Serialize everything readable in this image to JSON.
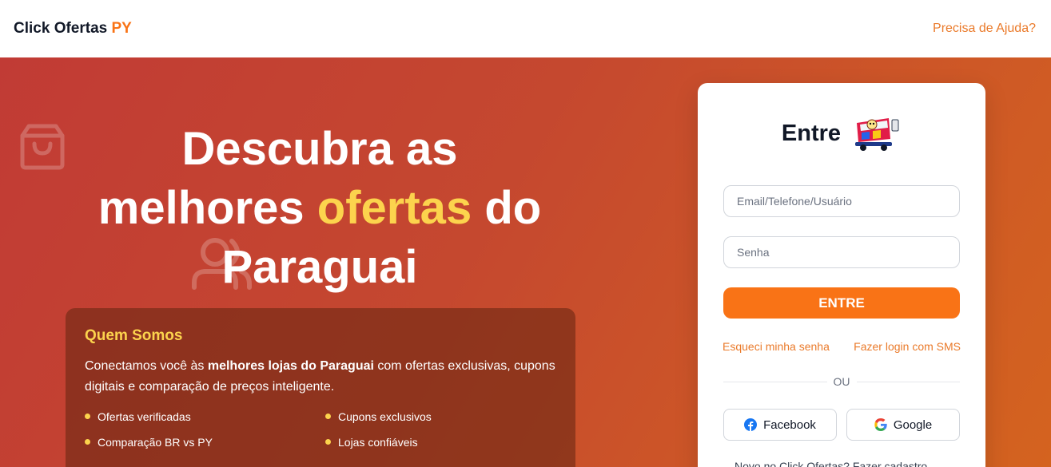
{
  "header": {
    "brand_main": "Click Ofertas ",
    "brand_accent": "PY",
    "help_link": "Precisa de Ajuda?"
  },
  "hero": {
    "headline_line1": "Descubra as",
    "headline_pre": "melhores ",
    "headline_highlight": "ofertas",
    "headline_post": " do",
    "headline_line3": "Paraguai",
    "background_icons": [
      "shopping-bag-icon",
      "user-icon"
    ],
    "colors": {
      "gradient_start": "#c13b35",
      "gradient_end": "#d4631f",
      "highlight": "#fcd34d"
    }
  },
  "about": {
    "title": "Quem Somos",
    "text_pre": "Conectamos você às ",
    "text_bold": "melhores lojas do Paraguai",
    "text_post": " com ofertas exclusivas, cupons digitais e comparação de preços inteligente.",
    "features": [
      "Ofertas verificadas",
      "Cupons exclusivos",
      "Comparação BR vs PY",
      "Lojas confiáveis"
    ]
  },
  "login": {
    "title": "Entre",
    "mascot_icon": "shopping-cart-mascot-icon",
    "user_placeholder": "Email/Telefone/Usuário",
    "user_value": "",
    "password_placeholder": "Senha",
    "password_value": "",
    "submit_label": "ENTRE",
    "forgot_password": "Esqueci minha senha",
    "sms_login": "Fazer login com SMS",
    "divider": "OU",
    "facebook_label": "Facebook",
    "google_label": "Google",
    "signup_text": "Novo no Click Ofertas? Fazer cadastro",
    "colors": {
      "primary": "#f97316",
      "link": "#ea7a2a",
      "facebook": "#1877f2"
    }
  }
}
